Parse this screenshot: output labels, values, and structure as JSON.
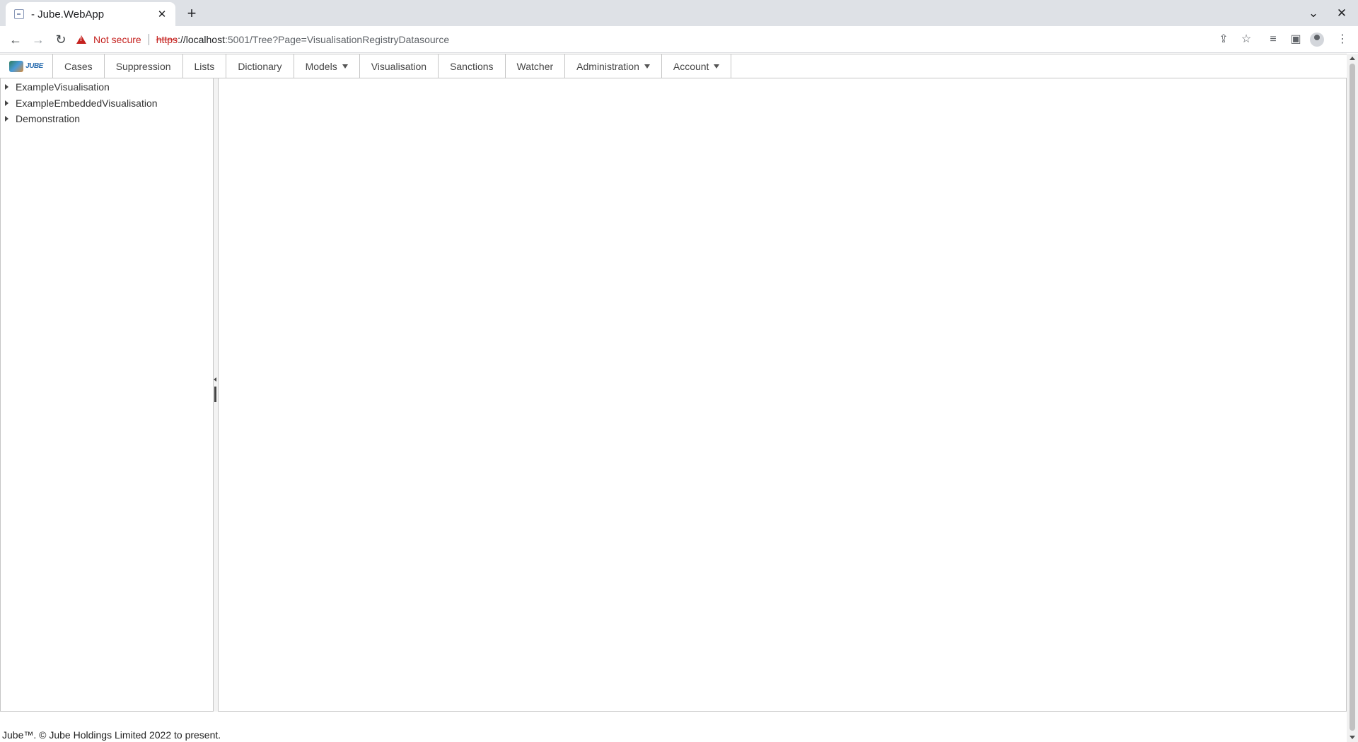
{
  "browser": {
    "tab_title": "- Jube.WebApp",
    "tab_close": "✕",
    "new_tab": "+",
    "security_label": "Not secure",
    "url_scheme": "https",
    "url_host": "://localhost",
    "url_rest": ":5001/Tree?Page=VisualisationRegistryDatasource",
    "icons": [
      "back-icon",
      "forward-icon",
      "reload-icon",
      "share-icon",
      "star-icon",
      "media-icon",
      "side-panel-icon",
      "profile-icon",
      "more-icon"
    ]
  },
  "app": {
    "logo_text": "JUBE",
    "menu": [
      {
        "label": "Cases"
      },
      {
        "label": "Suppression"
      },
      {
        "label": "Lists"
      },
      {
        "label": "Dictionary"
      },
      {
        "label": "Models",
        "dropdown": true
      },
      {
        "label": "Visualisation"
      },
      {
        "label": "Sanctions"
      },
      {
        "label": "Watcher"
      },
      {
        "label": "Administration",
        "dropdown": true
      },
      {
        "label": "Account",
        "dropdown": true
      }
    ],
    "tree": [
      {
        "label": "ExampleVisualisation"
      },
      {
        "label": "ExampleEmbeddedVisualisation"
      },
      {
        "label": "Demonstration"
      }
    ],
    "footer": "Jube™. © Jube Holdings Limited 2022 to present."
  }
}
